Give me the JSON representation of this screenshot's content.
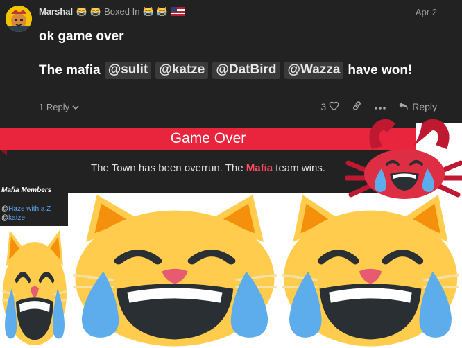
{
  "post": {
    "username": "Marshal",
    "user_title": "Boxed In",
    "date": "Apr 2",
    "line1": "ok game over",
    "line2_prefix": "The mafia",
    "mentions": [
      "@sulit",
      "@katze",
      "@DatBird",
      "@Wazza"
    ],
    "line2_suffix": "have won!",
    "replies_label": "1 Reply",
    "likes_count": "3",
    "reply_label": "Reply"
  },
  "game_over": {
    "banner": "Game Over",
    "message_before": "The Town has been overrun. The",
    "message_highlight": "Mafia",
    "message_after": "team wins.",
    "accent": "#e8253c"
  },
  "mafia_members": {
    "title": "Mafia Members",
    "members": [
      {
        "at": "@",
        "name": "Haze with a Z"
      },
      {
        "at": "@",
        "name": "katze"
      }
    ]
  },
  "emojis": [
    "crab-emoji",
    "joy-cat-emoji",
    "joy-cat-emoji",
    "joy-cat-emoji"
  ],
  "colors": {
    "post_bg": "#222222",
    "link": "#5aa6ee",
    "cat_yellow": "#ffcc4d",
    "tear_blue": "#5dadec"
  }
}
